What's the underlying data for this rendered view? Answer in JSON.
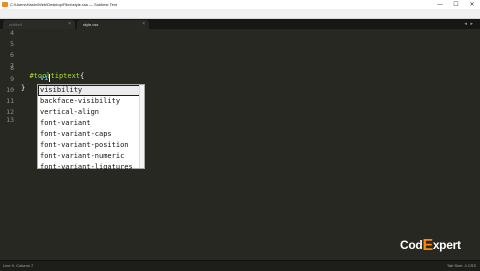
{
  "window": {
    "title": "C:\\Users\\Hasin\\Web\\Desktop\\Files\\style.css — Sublime Text",
    "controls": {
      "minimize": "—",
      "maximize": "☐",
      "close": "✕"
    }
  },
  "menu": [
    "File",
    "Edit",
    "Selection",
    "Find",
    "View",
    "Goto",
    "Tools",
    "Project",
    "Preferences",
    "Help"
  ],
  "tabs": [
    {
      "label": "untitled",
      "close": "×"
    },
    {
      "label": "style.css",
      "close": "×"
    }
  ],
  "tab_nav": "◂ ▸",
  "editor": {
    "line_numbers": [
      "4",
      "5",
      "6",
      "7",
      "8",
      "9",
      "10",
      "11",
      "12",
      "13"
    ],
    "selector": "#tooltiptext",
    "open_brace": "{",
    "typed": "vi",
    "close_brace": "}"
  },
  "autocomplete": {
    "items": [
      "visibility",
      "backface-visibility",
      "vertical-align",
      "font-variant",
      "font-variant-caps",
      "font-variant-position",
      "font-variant-numeric",
      "font-variant-ligatures"
    ],
    "selected_index": 0
  },
  "watermark": {
    "before": "Cod",
    "accent": "E",
    "after": "xpert"
  },
  "status": {
    "left": "Line 9, Column 7",
    "right": "Tab Size: 4     CSS"
  },
  "colors": {
    "editor_bg": "#272822",
    "selector": "#a6e22e",
    "brace": "#f8f8f2",
    "property": "#66d9ef",
    "logo_accent": "#ff8c00"
  }
}
